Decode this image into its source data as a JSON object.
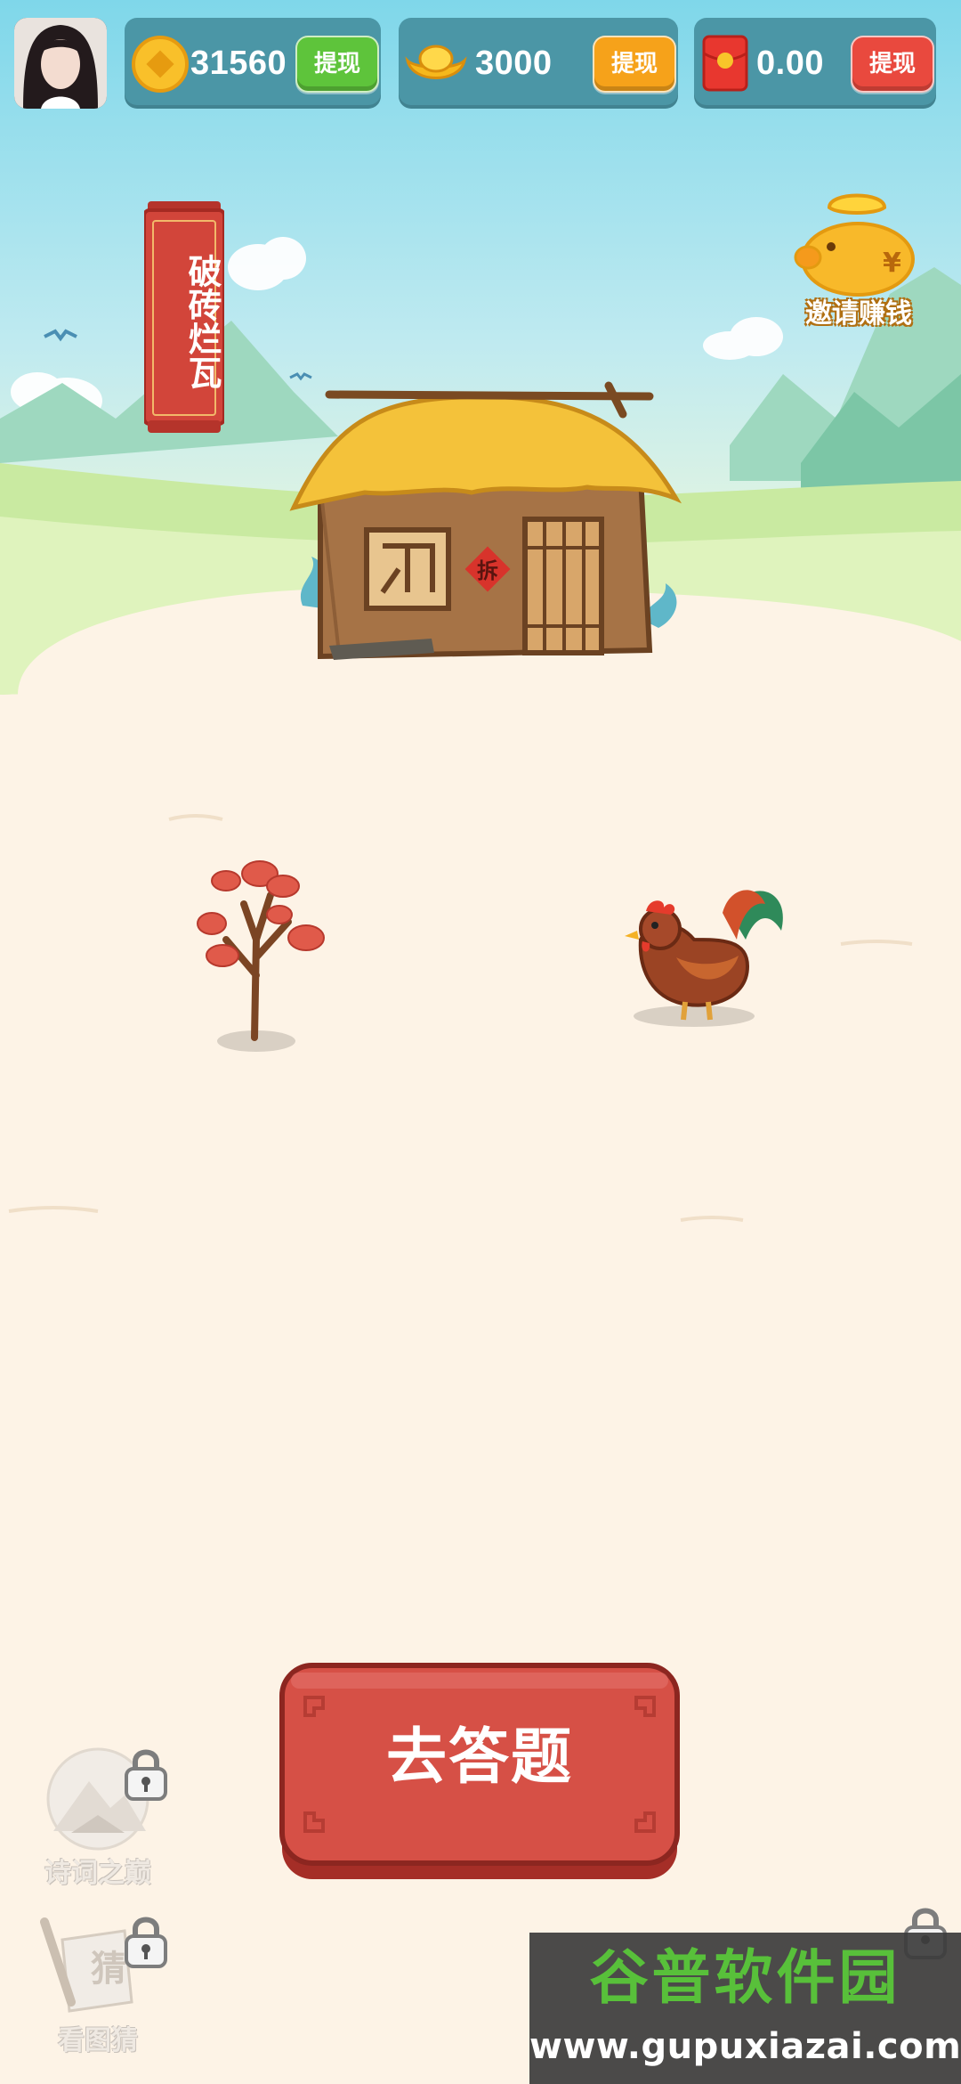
{
  "top_bar": {
    "coins": {
      "value": "31560",
      "withdraw_label": "提现",
      "icon": "gold-coin-icon"
    },
    "ingots": {
      "value": "3000",
      "withdraw_label": "提现",
      "icon": "gold-ingot-icon"
    },
    "red_packet": {
      "value": "0.00",
      "withdraw_label": "提现",
      "icon": "red-envelope-icon"
    }
  },
  "stage": {
    "name": "破砖烂瓦"
  },
  "invite": {
    "label": "邀请赚钱",
    "icon": "piggy-bank-icon"
  },
  "house": {
    "door_sign": "拆"
  },
  "primary_action": {
    "label": "去答题"
  },
  "games": [
    {
      "label": "诗词之巅",
      "locked": true
    },
    {
      "label": "看图猜",
      "locked": true,
      "badge": "猜"
    }
  ],
  "watermark": {
    "title": "谷普软件园",
    "url": "www.gupuxiazai.com"
  },
  "colors": {
    "sky_top": "#7fd7ea",
    "ground": "#fdf3e6",
    "pill": "#4b96a6",
    "button_red": "#d65046",
    "withdraw_green": "#5ec43b",
    "withdraw_orange": "#f6a21a",
    "withdraw_red": "#e9493e"
  }
}
